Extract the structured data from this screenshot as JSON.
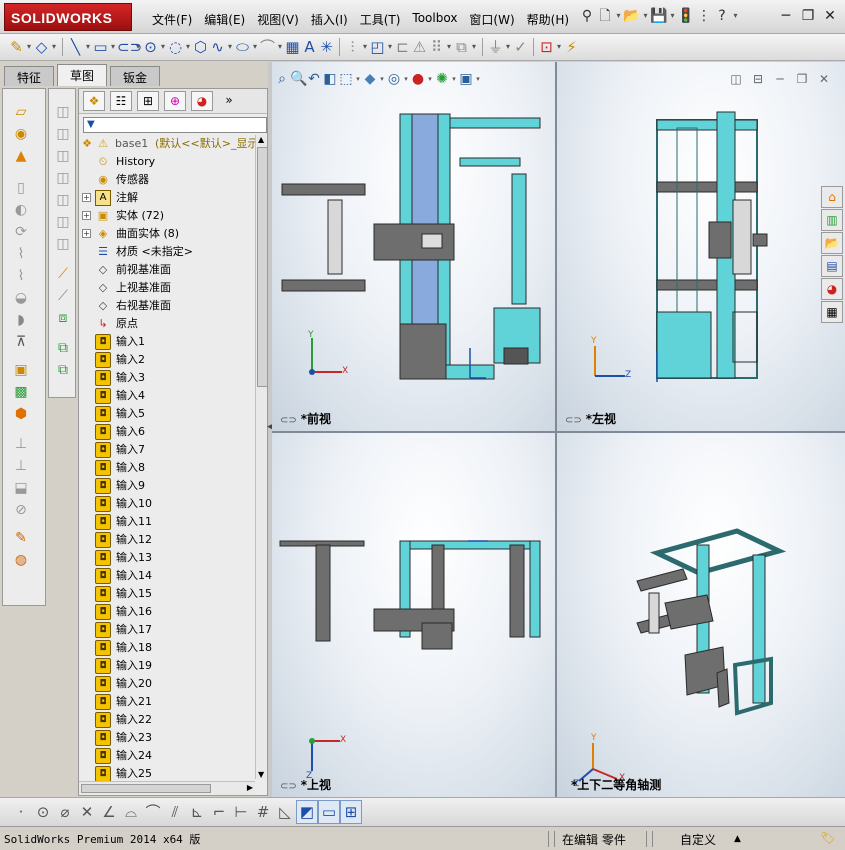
{
  "app": {
    "brand": "SOLIDWORKS",
    "brand_color": "#c81f1f"
  },
  "menu": [
    {
      "id": "file",
      "label": "文件(F)"
    },
    {
      "id": "edit",
      "label": "编辑(E)"
    },
    {
      "id": "view",
      "label": "视图(V)"
    },
    {
      "id": "insert",
      "label": "插入(I)"
    },
    {
      "id": "tools",
      "label": "工具(T)"
    },
    {
      "id": "toolbox",
      "label": "Toolbox"
    },
    {
      "id": "window",
      "label": "窗口(W)"
    },
    {
      "id": "help",
      "label": "帮助(H)"
    }
  ],
  "quick_access_help": "?",
  "tabs": [
    {
      "id": "feature",
      "label": "特征",
      "active": false
    },
    {
      "id": "sketch",
      "label": "草图",
      "active": true
    },
    {
      "id": "sheetmetal",
      "label": "钣金",
      "active": false
    }
  ],
  "tree": {
    "root_name": "base1",
    "root_config": "(默认<<默认>_显示",
    "items": [
      {
        "label": "History",
        "icon": "history-icon",
        "expandable": false
      },
      {
        "label": "传感器",
        "icon": "sensor-icon",
        "expandable": false
      },
      {
        "label": "注解",
        "icon": "annotation-icon",
        "expandable": true
      },
      {
        "label": "实体 (72)",
        "icon": "solid-bodies-icon",
        "expandable": true
      },
      {
        "label": "曲面实体 (8)",
        "icon": "surface-bodies-icon",
        "expandable": true
      },
      {
        "label": "材质 <未指定>",
        "icon": "material-icon",
        "expandable": false
      },
      {
        "label": "前视基准面",
        "icon": "plane-icon",
        "expandable": false
      },
      {
        "label": "上视基准面",
        "icon": "plane-icon",
        "expandable": false
      },
      {
        "label": "右视基准面",
        "icon": "plane-icon",
        "expandable": false
      },
      {
        "label": "原点",
        "icon": "origin-icon",
        "expandable": false
      },
      {
        "label": "输入1",
        "icon": "imported-body-icon",
        "expandable": false
      },
      {
        "label": "输入2",
        "icon": "imported-body-icon",
        "expandable": false
      },
      {
        "label": "输入3",
        "icon": "imported-body-icon",
        "expandable": false
      },
      {
        "label": "输入4",
        "icon": "imported-body-icon",
        "expandable": false
      },
      {
        "label": "输入5",
        "icon": "imported-body-icon",
        "expandable": false
      },
      {
        "label": "输入6",
        "icon": "imported-body-icon",
        "expandable": false
      },
      {
        "label": "输入7",
        "icon": "imported-body-icon",
        "expandable": false
      },
      {
        "label": "输入8",
        "icon": "imported-body-icon",
        "expandable": false
      },
      {
        "label": "输入9",
        "icon": "imported-body-icon",
        "expandable": false
      },
      {
        "label": "输入10",
        "icon": "imported-body-icon",
        "expandable": false
      },
      {
        "label": "输入11",
        "icon": "imported-body-icon",
        "expandable": false
      },
      {
        "label": "输入12",
        "icon": "imported-body-icon",
        "expandable": false
      },
      {
        "label": "输入13",
        "icon": "imported-body-icon",
        "expandable": false
      },
      {
        "label": "输入14",
        "icon": "imported-body-icon",
        "expandable": false
      },
      {
        "label": "输入15",
        "icon": "imported-body-icon",
        "expandable": false
      },
      {
        "label": "输入16",
        "icon": "imported-body-icon",
        "expandable": false
      },
      {
        "label": "输入17",
        "icon": "imported-body-icon",
        "expandable": false
      },
      {
        "label": "输入18",
        "icon": "imported-body-icon",
        "expandable": false
      },
      {
        "label": "输入19",
        "icon": "imported-body-icon",
        "expandable": false
      },
      {
        "label": "输入20",
        "icon": "imported-body-icon",
        "expandable": false
      },
      {
        "label": "输入21",
        "icon": "imported-body-icon",
        "expandable": false
      },
      {
        "label": "输入22",
        "icon": "imported-body-icon",
        "expandable": false
      },
      {
        "label": "输入23",
        "icon": "imported-body-icon",
        "expandable": false
      },
      {
        "label": "输入24",
        "icon": "imported-body-icon",
        "expandable": false
      },
      {
        "label": "输入25",
        "icon": "imported-body-icon",
        "expandable": false
      }
    ]
  },
  "viewports": [
    {
      "id": "front",
      "label": "*前视"
    },
    {
      "id": "left",
      "label": "*左视"
    },
    {
      "id": "top",
      "label": "*上视"
    },
    {
      "id": "iso",
      "label": "*上下二等角轴测"
    }
  ],
  "axes": {
    "x": "X",
    "y": "Y",
    "z": "Z"
  },
  "model_color": "#5fd3d8",
  "status": {
    "product": "SolidWorks Premium 2014 x64 版",
    "mode": "在编辑 零件",
    "units": "自定义"
  }
}
